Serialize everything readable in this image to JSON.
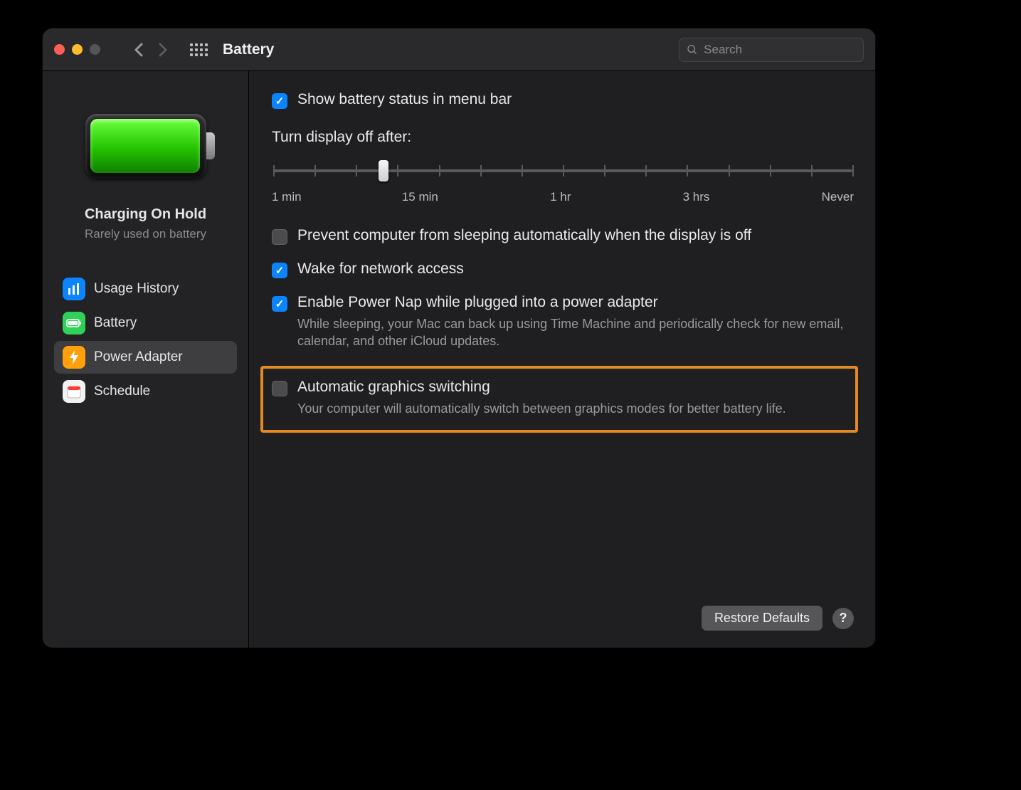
{
  "window": {
    "title": "Battery",
    "search_placeholder": "Search"
  },
  "sidebar": {
    "status_title": "Charging On Hold",
    "status_subtitle": "Rarely used on battery",
    "items": [
      {
        "label": "Usage History"
      },
      {
        "label": "Battery"
      },
      {
        "label": "Power Adapter"
      },
      {
        "label": "Schedule"
      }
    ]
  },
  "settings": {
    "show_status_label": "Show battery status in menu bar",
    "slider_title": "Turn display off after:",
    "slider_ticks_count": 15,
    "slider_knob_position_pct": 19,
    "slider_labels": [
      "1 min",
      "15 min",
      "1 hr",
      "3 hrs",
      "Never"
    ],
    "options": [
      {
        "label": "Prevent computer from sleeping automatically when the display is off",
        "checked": false,
        "desc": ""
      },
      {
        "label": "Wake for network access",
        "checked": true,
        "desc": ""
      },
      {
        "label": "Enable Power Nap while plugged into a power adapter",
        "checked": true,
        "desc": "While sleeping, your Mac can back up using Time Machine and periodically check for new email, calendar, and other iCloud updates."
      },
      {
        "label": "Automatic graphics switching",
        "checked": false,
        "desc": "Your computer will automatically switch between graphics modes for better battery life."
      }
    ]
  },
  "footer": {
    "restore_label": "Restore Defaults",
    "help_label": "?"
  }
}
